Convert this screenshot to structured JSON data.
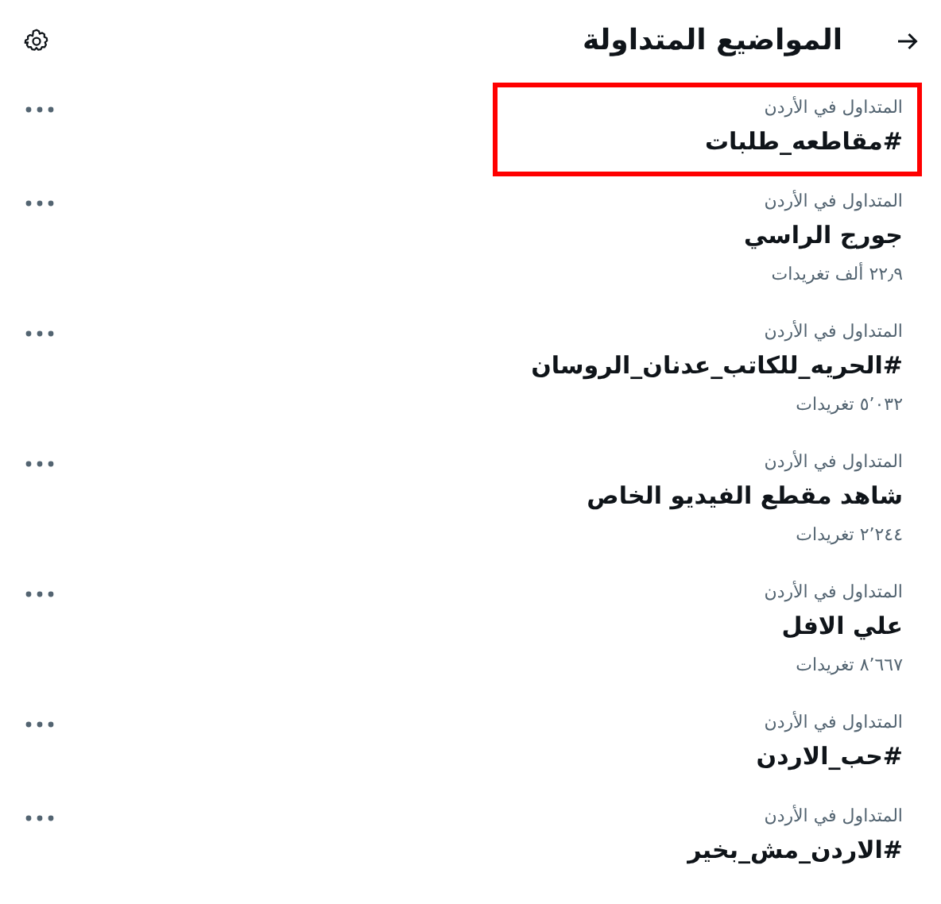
{
  "header": {
    "title": "المواضيع المتداولة"
  },
  "trends": [
    {
      "context": "المتداول في الأردن",
      "topic": "#مقاطعه_طلبات",
      "highlighted": true
    },
    {
      "context": "المتداول في الأردن",
      "topic": "جورج الراسي",
      "count": "٢٢٫٩ ألف تغريدات",
      "highlighted": false
    },
    {
      "context": "المتداول في الأردن",
      "topic": "#الحريه_للكاتب_عدنان_الروسان",
      "count": "٥٬٠٣٢ تغريدات",
      "highlighted": false
    },
    {
      "context": "المتداول في الأردن",
      "topic": "شاهد مقطع الفيديو الخاص",
      "count": "٢٬٢٤٤ تغريدات",
      "highlighted": false
    },
    {
      "context": "المتداول في الأردن",
      "topic": "علي الافل",
      "count": "٨٬٦٦٧ تغريدات",
      "highlighted": false
    },
    {
      "context": "المتداول في الأردن",
      "topic": "#حب_الاردن",
      "highlighted": false
    },
    {
      "context": "المتداول في الأردن",
      "topic": "#الاردن_مش_بخير",
      "highlighted": false
    }
  ]
}
